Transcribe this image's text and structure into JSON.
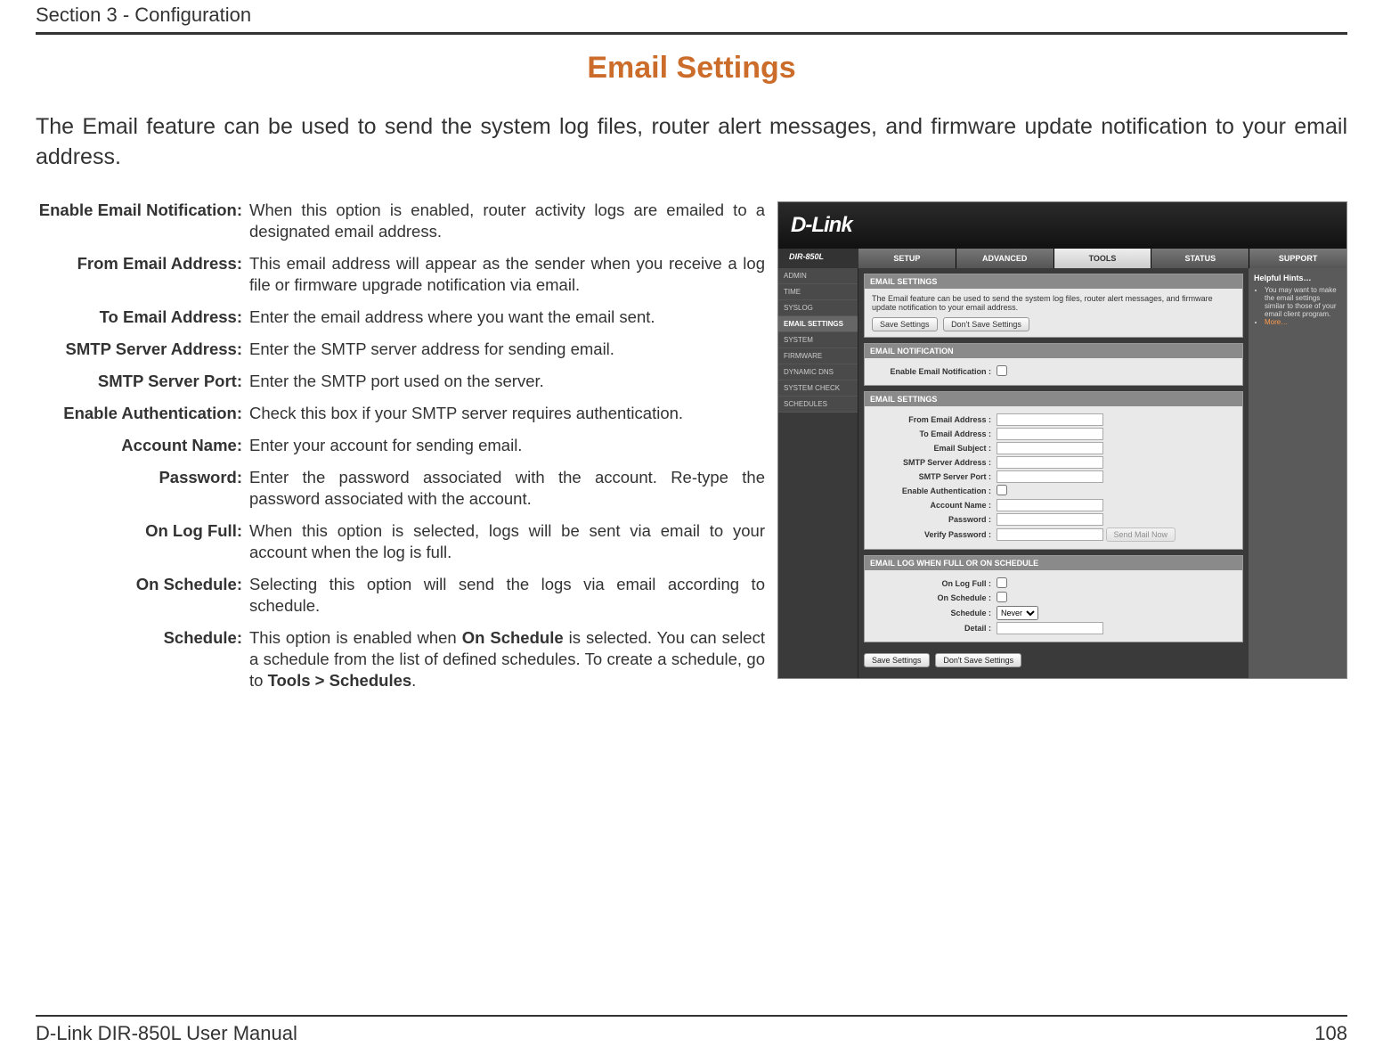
{
  "header": {
    "section": "Section 3 - Configuration"
  },
  "title": "Email Settings",
  "intro": "The Email feature can be used to send the system log files, router alert messages, and firmware update notification to your email address.",
  "defs": [
    {
      "label": "Enable Email Notification:",
      "html": "When this option is enabled, router activity logs are emailed to a designated email address."
    },
    {
      "label": "From Email Address:",
      "html": "This email address will appear as the sender when you receive a log file or firmware upgrade notification via email."
    },
    {
      "label": "To Email Address:",
      "html": "Enter the email address where you want the email sent."
    },
    {
      "label": "SMTP Server Address:",
      "html": "Enter the SMTP server address for sending email."
    },
    {
      "label": "SMTP Server Port:",
      "html": "Enter the SMTP port used on the server."
    },
    {
      "label": "Enable Authentication:",
      "html": "Check this box if your SMTP server requires authentication."
    },
    {
      "label": "Account Name:",
      "html": "Enter your account for sending email."
    },
    {
      "label": "Password:",
      "html": "Enter the password associated with the account. Re-type the password associated with the account."
    },
    {
      "label": "On Log Full:",
      "html": "When this option is selected, logs will be sent via email to your account when the log is full."
    },
    {
      "label": "On Schedule:",
      "html": "Selecting this option will send the logs via email according to schedule."
    },
    {
      "label": "Schedule:",
      "html": "This option is enabled when <b>On Schedule</b> is selected. You can select a schedule from the list of defined schedules. To create a schedule, go to <b>Tools > Schedules</b>."
    }
  ],
  "router": {
    "logo": "D-Link",
    "model": "DIR-850L",
    "tabs": [
      "SETUP",
      "ADVANCED",
      "TOOLS",
      "STATUS",
      "SUPPORT"
    ],
    "active_tab": 2,
    "side": [
      "ADMIN",
      "TIME",
      "SYSLOG",
      "EMAIL SETTINGS",
      "SYSTEM",
      "FIRMWARE",
      "DYNAMIC DNS",
      "SYSTEM CHECK",
      "SCHEDULES"
    ],
    "side_active": 3,
    "panel1": {
      "hdr": "EMAIL SETTINGS",
      "desc": "The Email feature can be used to send the system log files, router alert messages, and firmware update notification to your email address.",
      "btn_save": "Save Settings",
      "btn_cancel": "Don't Save Settings"
    },
    "panel2": {
      "hdr": "EMAIL NOTIFICATION",
      "row": "Enable Email Notification :"
    },
    "panel3": {
      "hdr": "EMAIL SETTINGS",
      "rows": [
        "From Email Address :",
        "To Email Address :",
        "Email Subject :",
        "SMTP Server Address :",
        "SMTP Server Port :",
        "Enable Authentication :",
        "Account Name :",
        "Password :",
        "Verify Password :"
      ]
    },
    "panel4": {
      "hdr": "EMAIL LOG WHEN FULL OR ON SCHEDULE",
      "rows": [
        "On Log Full :",
        "On Schedule :",
        "Schedule :",
        "Detail :"
      ],
      "schedule_option": "Never"
    },
    "hints": {
      "hdr": "Helpful Hints…",
      "text": "You may want to make the email settings similar to those of your email client program.",
      "more": "More…"
    },
    "send_mail_now": "Send Mail Now"
  },
  "footer": {
    "left": "D-Link DIR-850L User Manual",
    "right": "108"
  }
}
